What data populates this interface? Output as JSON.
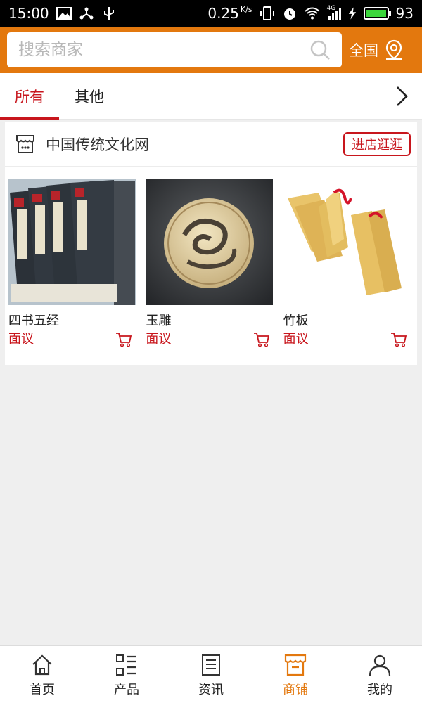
{
  "status_bar": {
    "time": "15:00",
    "speed": "0.25",
    "speed_unit": "K/s",
    "network": "4G",
    "battery": "93"
  },
  "search": {
    "placeholder": "搜索商家",
    "region_label": "全国"
  },
  "tabs": [
    {
      "label": "所有",
      "active": true
    },
    {
      "label": "其他",
      "active": false
    }
  ],
  "shop": {
    "name": "中国传统文化网",
    "visit_button": "进店逛逛",
    "products": [
      {
        "name": "四书五经",
        "price": "面议",
        "image": "book-set"
      },
      {
        "name": "玉雕",
        "price": "面议",
        "image": "jade-carving"
      },
      {
        "name": "竹板",
        "price": "面议",
        "image": "bamboo-clappers"
      }
    ]
  },
  "bottom_nav": [
    {
      "label": "首页",
      "icon": "home-icon",
      "active": false
    },
    {
      "label": "产品",
      "icon": "product-list-icon",
      "active": false
    },
    {
      "label": "资讯",
      "icon": "news-icon",
      "active": false
    },
    {
      "label": "商铺",
      "icon": "shop-icon",
      "active": true
    },
    {
      "label": "我的",
      "icon": "user-icon",
      "active": false
    }
  ],
  "colors": {
    "brand": "#e3780e",
    "accent": "#c8161d",
    "background": "#efefef"
  }
}
